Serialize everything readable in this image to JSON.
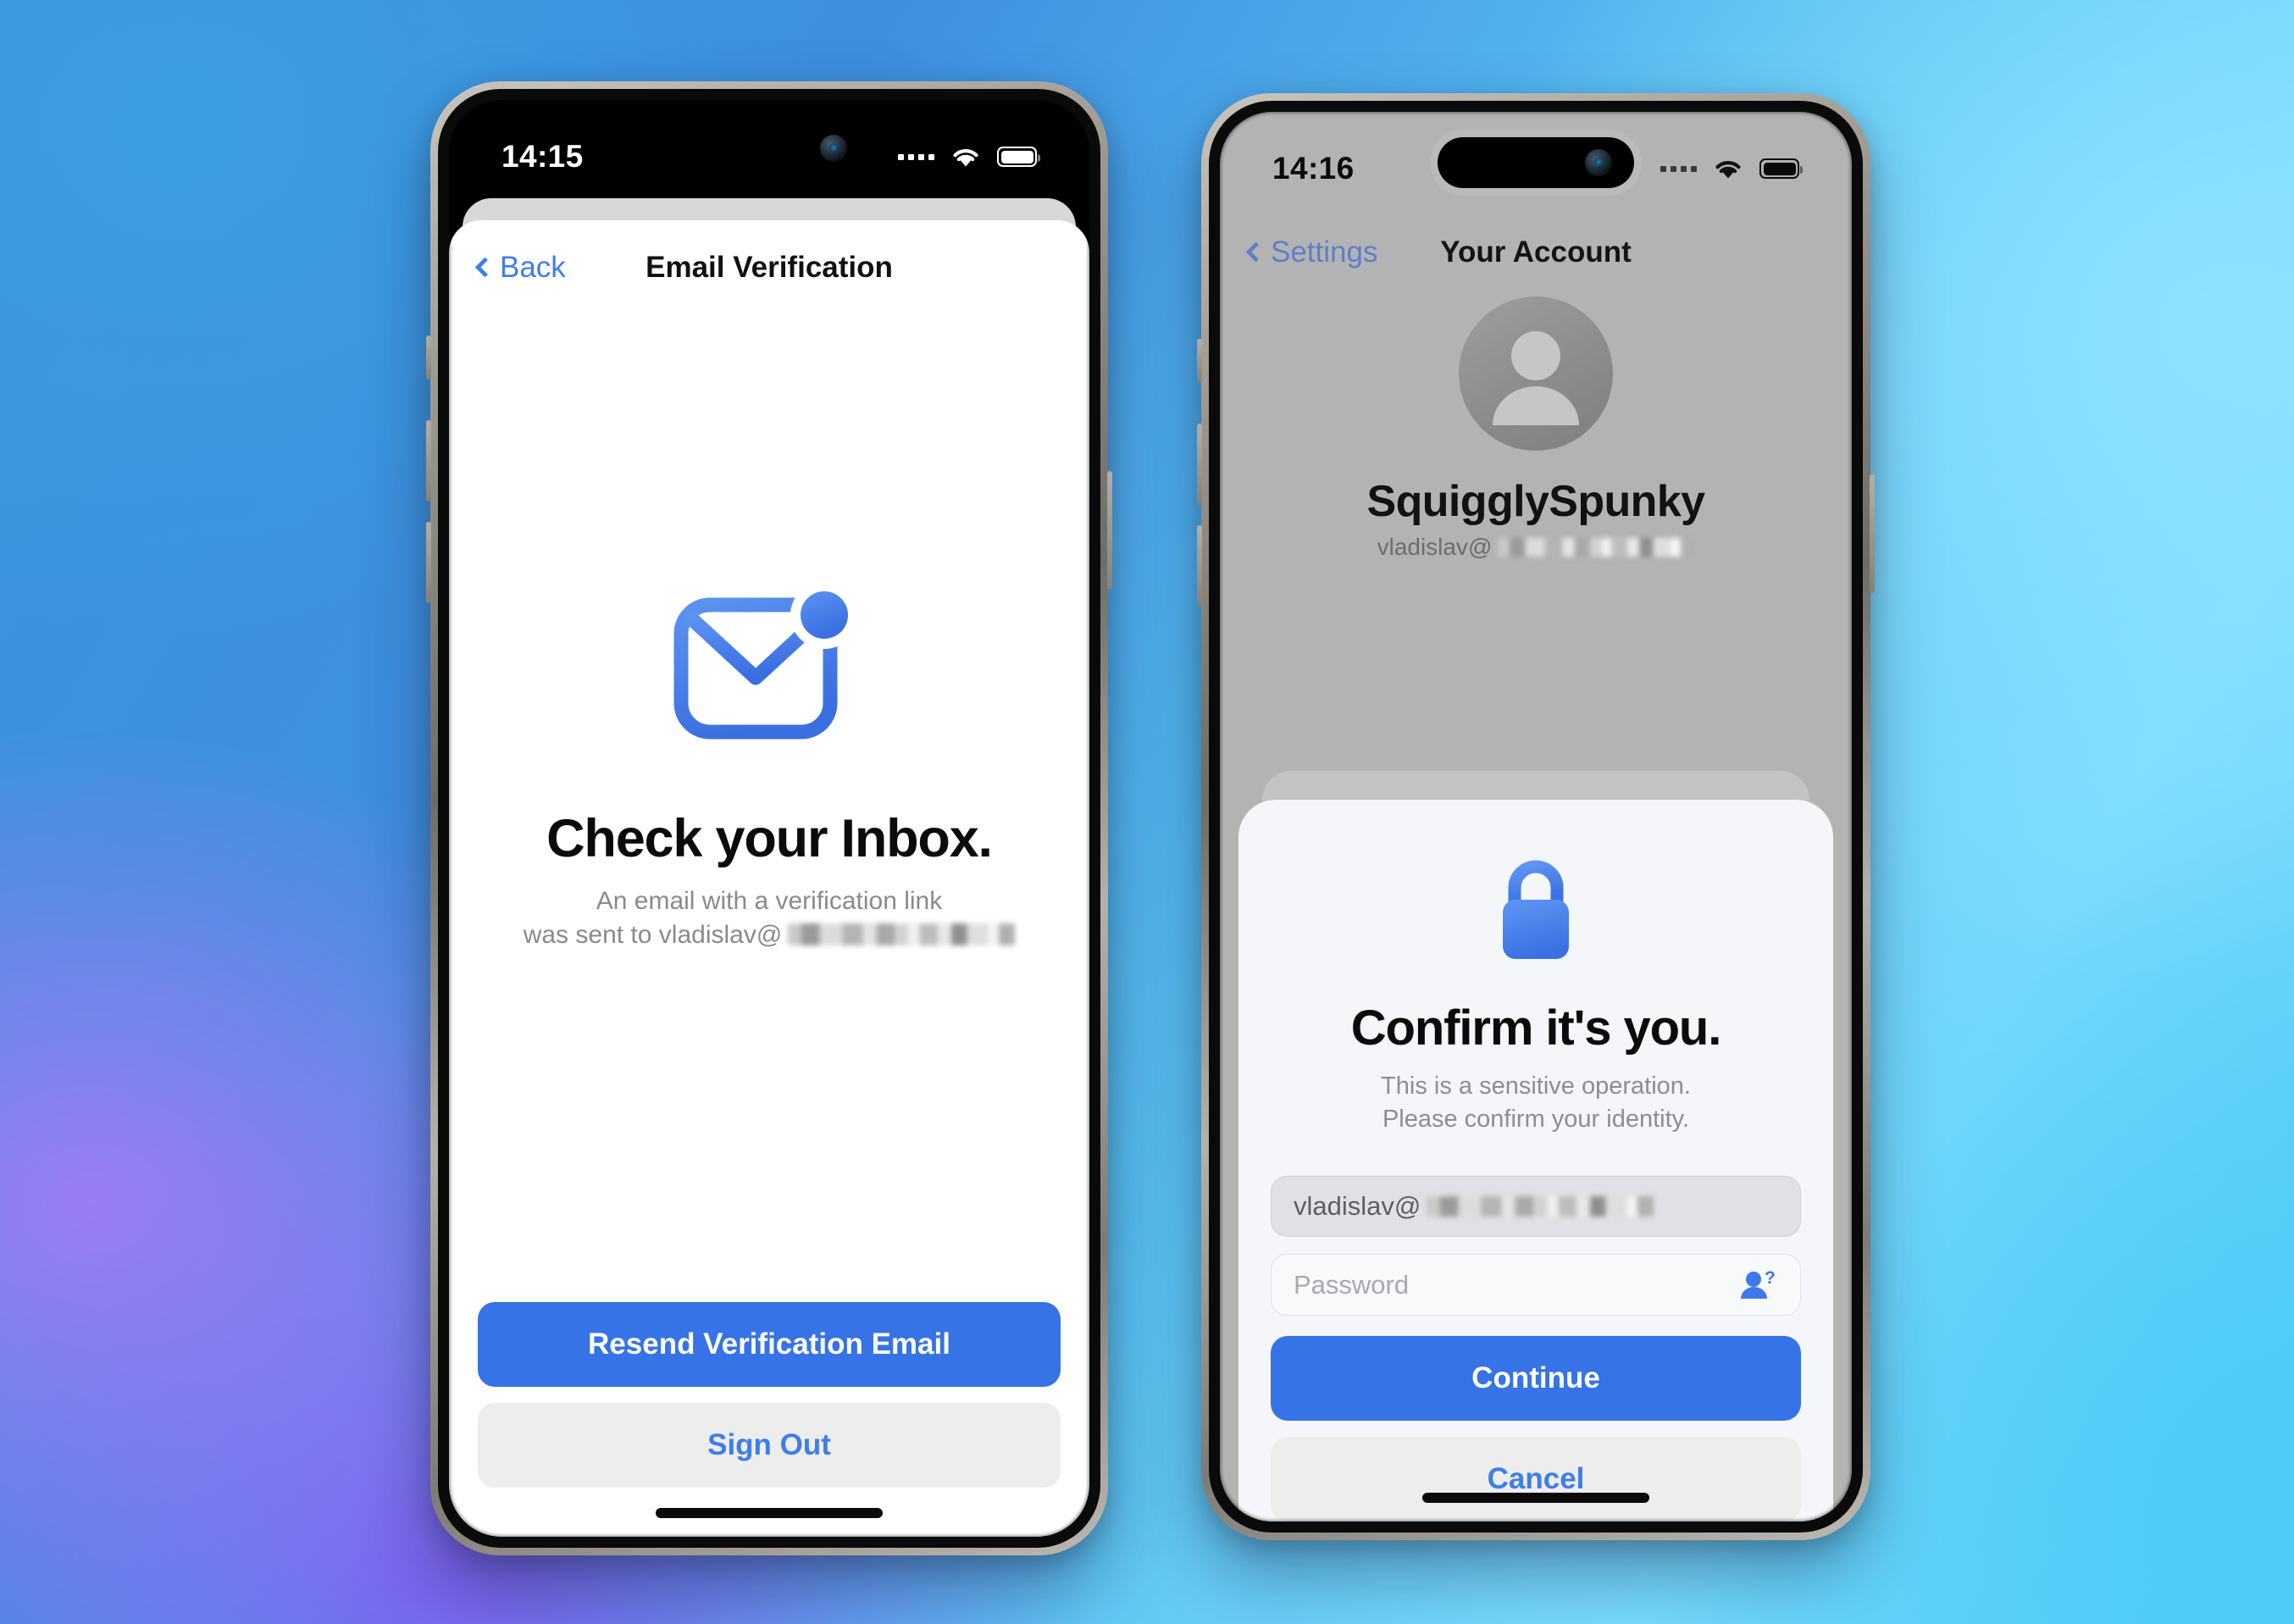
{
  "background": {
    "gradient_colors": [
      "#3a93dd",
      "#8fe2ff",
      "#7d63f0",
      "#4ecbf7",
      "#9a7cf5"
    ]
  },
  "theme": {
    "primary_blue": "#3573e6",
    "link_blue": "#3e7ee8",
    "secondary_fill": "#ededee",
    "sheet_bg": "#f5f6f9",
    "dim_bg": "#b3b3b3"
  },
  "left_phone": {
    "status_bar": {
      "time": "14:15"
    },
    "nav": {
      "back_label": "Back",
      "title": "Email Verification"
    },
    "hero": {
      "icon": "envelope-notification-icon",
      "title": "Check your Inbox.",
      "subtitle_line1": "An email with a verification link",
      "subtitle_line2_prefix": "was sent to vladislav@",
      "subtitle_line2_redacted": true
    },
    "actions": {
      "primary_label": "Resend Verification Email",
      "secondary_label": "Sign Out"
    }
  },
  "right_phone": {
    "status_bar": {
      "time": "14:16"
    },
    "nav": {
      "back_label": "Settings",
      "title": "Your Account"
    },
    "account": {
      "avatar_icon": "person-avatar-icon",
      "username": "SquigglySpunky",
      "email_prefix": "vladislav@",
      "email_redacted": true
    },
    "modal": {
      "icon": "lock-icon",
      "title": "Confirm it's you.",
      "subtitle_line1": "This is a sensitive operation.",
      "subtitle_line2": "Please confirm your identity.",
      "email_field": {
        "value_prefix": "vladislav@",
        "redacted": true,
        "disabled": true
      },
      "password_field": {
        "placeholder": "Password",
        "value": "",
        "trailing_icon": "person-question-icon"
      },
      "primary_label": "Continue",
      "secondary_label": "Cancel"
    }
  }
}
